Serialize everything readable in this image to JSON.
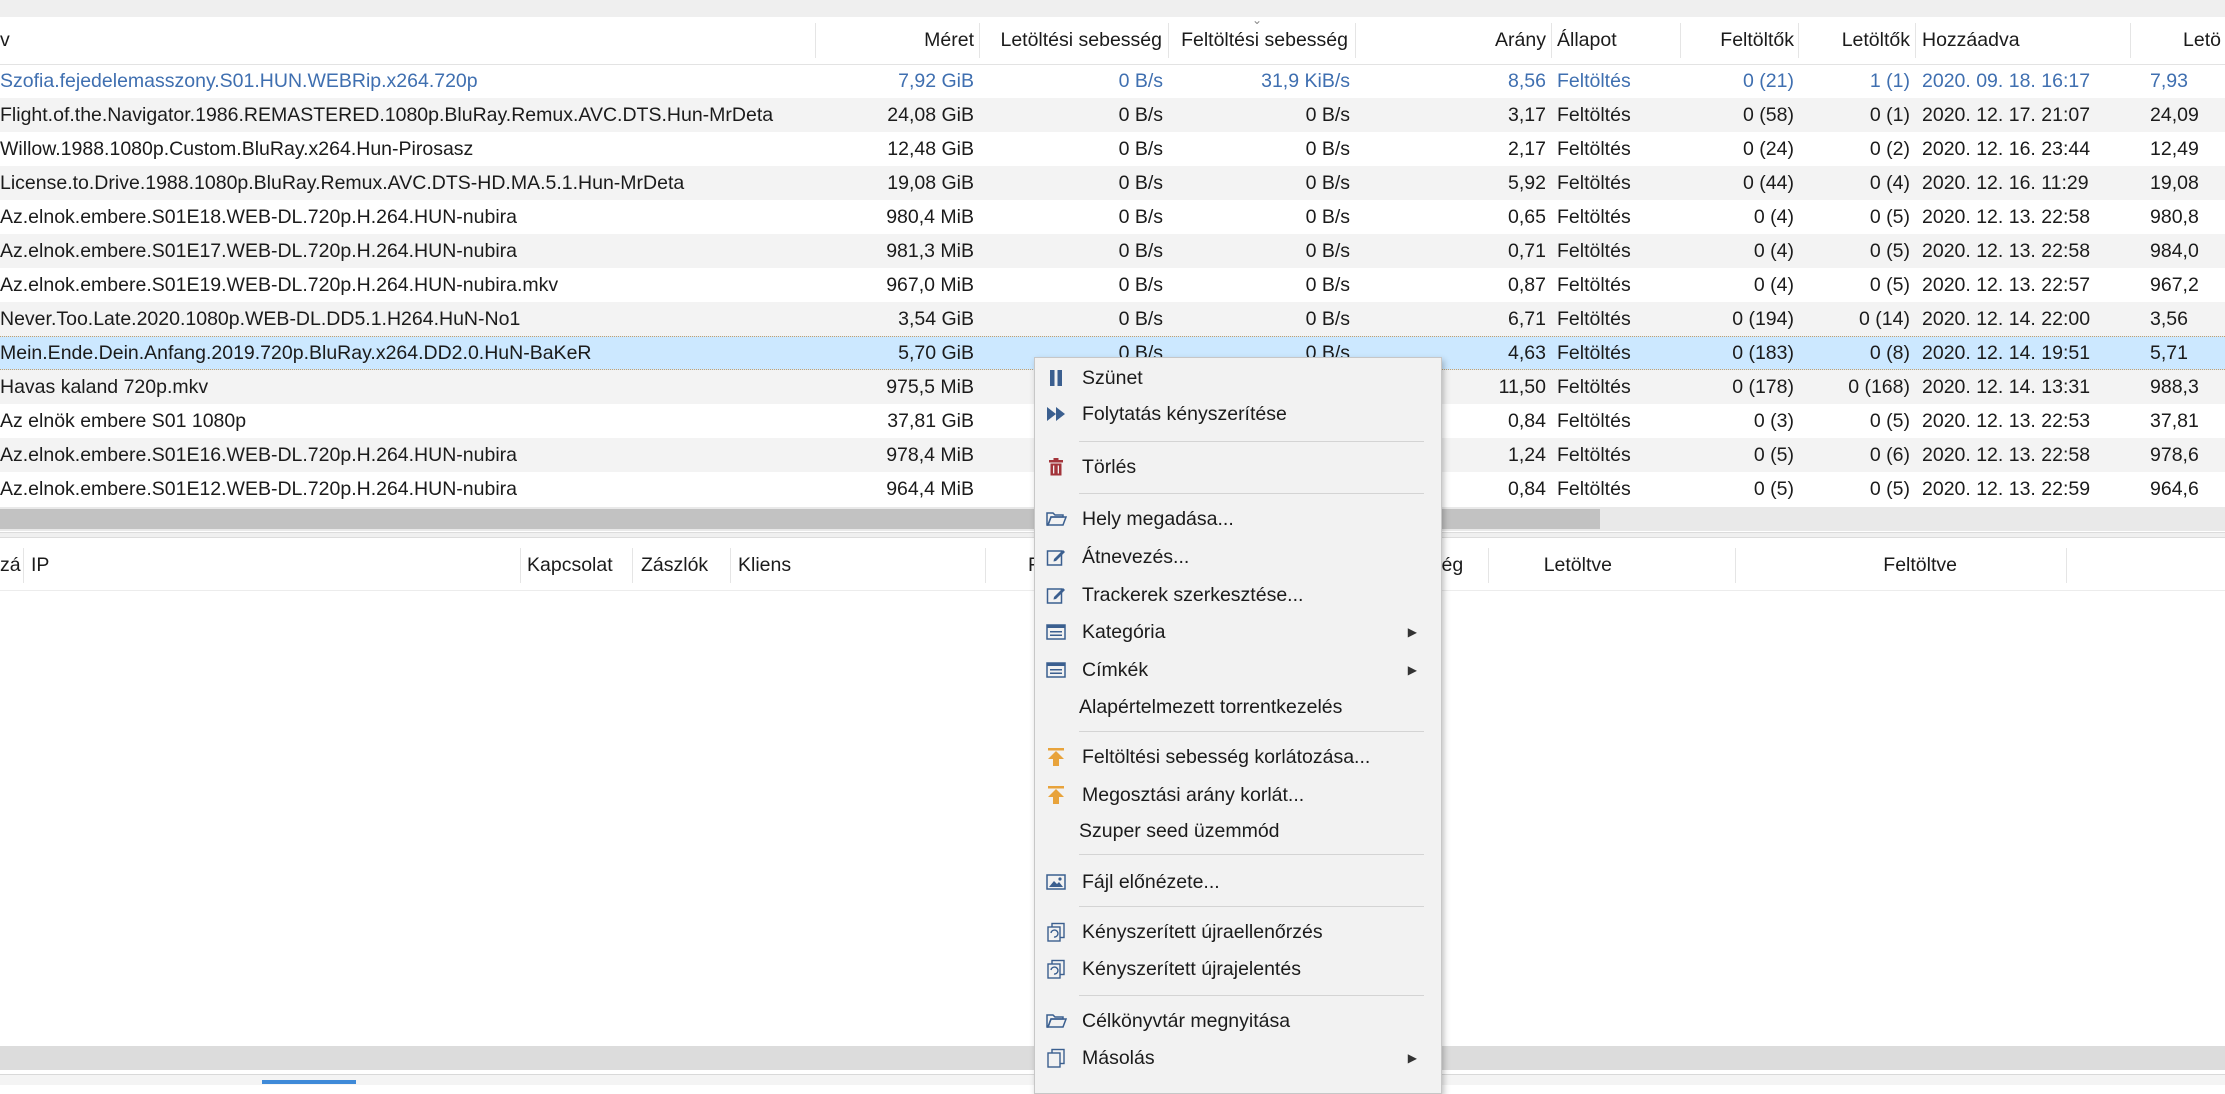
{
  "columns": {
    "name": "v",
    "size": "Méret",
    "dl_speed": "Letöltési sebesség",
    "ul_speed": "Feltöltési sebesség",
    "ratio": "Arány",
    "state": "Állapot",
    "seeds": "Feltöltők",
    "peers": "Letöltők",
    "added": "Hozzáadva",
    "extra": "Letö"
  },
  "torrents": [
    {
      "name": "Szofia.fejedelemasszony.S01.HUN.WEBRip.x264.720p",
      "size": "7,92 GiB",
      "dl": "0 B/s",
      "ul": "31,9 KiB/s",
      "ratio": "8,56",
      "state": "Feltöltés",
      "seeds": "0 (21)",
      "peers": "1 (1)",
      "added": "2020. 09. 18. 16:17",
      "extra": "7,93"
    },
    {
      "name": "Flight.of.the.Navigator.1986.REMASTERED.1080p.BluRay.Remux.AVC.DTS.Hun-MrDeta",
      "size": "24,08 GiB",
      "dl": "0 B/s",
      "ul": "0 B/s",
      "ratio": "3,17",
      "state": "Feltöltés",
      "seeds": "0 (58)",
      "peers": "0 (1)",
      "added": "2020. 12. 17. 21:07",
      "extra": "24,09"
    },
    {
      "name": "Willow.1988.1080p.Custom.BluRay.x264.Hun-Pirosasz",
      "size": "12,48 GiB",
      "dl": "0 B/s",
      "ul": "0 B/s",
      "ratio": "2,17",
      "state": "Feltöltés",
      "seeds": "0 (24)",
      "peers": "0 (2)",
      "added": "2020. 12. 16. 23:44",
      "extra": "12,49"
    },
    {
      "name": "License.to.Drive.1988.1080p.BluRay.Remux.AVC.DTS-HD.MA.5.1.Hun-MrDeta",
      "size": "19,08 GiB",
      "dl": "0 B/s",
      "ul": "0 B/s",
      "ratio": "5,92",
      "state": "Feltöltés",
      "seeds": "0 (44)",
      "peers": "0 (4)",
      "added": "2020. 12. 16. 11:29",
      "extra": "19,08"
    },
    {
      "name": "Az.elnok.embere.S01E18.WEB-DL.720p.H.264.HUN-nubira",
      "size": "980,4 MiB",
      "dl": "0 B/s",
      "ul": "0 B/s",
      "ratio": "0,65",
      "state": "Feltöltés",
      "seeds": "0 (4)",
      "peers": "0 (5)",
      "added": "2020. 12. 13. 22:58",
      "extra": "980,8"
    },
    {
      "name": "Az.elnok.embere.S01E17.WEB-DL.720p.H.264.HUN-nubira",
      "size": "981,3 MiB",
      "dl": "0 B/s",
      "ul": "0 B/s",
      "ratio": "0,71",
      "state": "Feltöltés",
      "seeds": "0 (4)",
      "peers": "0 (5)",
      "added": "2020. 12. 13. 22:58",
      "extra": "984,0"
    },
    {
      "name": "Az.elnok.embere.S01E19.WEB-DL.720p.H.264.HUN-nubira.mkv",
      "size": "967,0 MiB",
      "dl": "0 B/s",
      "ul": "0 B/s",
      "ratio": "0,87",
      "state": "Feltöltés",
      "seeds": "0 (4)",
      "peers": "0 (5)",
      "added": "2020. 12. 13. 22:57",
      "extra": "967,2"
    },
    {
      "name": "Never.Too.Late.2020.1080p.WEB-DL.DD5.1.H264.HuN-No1",
      "size": "3,54 GiB",
      "dl": "0 B/s",
      "ul": "0 B/s",
      "ratio": "6,71",
      "state": "Feltöltés",
      "seeds": "0 (194)",
      "peers": "0 (14)",
      "added": "2020. 12. 14. 22:00",
      "extra": "3,56"
    },
    {
      "name": "Mein.Ende.Dein.Anfang.2019.720p.BluRay.x264.DD2.0.HuN-BaKeR",
      "size": "5,70 GiB",
      "dl": "0 B/s",
      "ul": "0 B/s",
      "ratio": "4,63",
      "state": "Feltöltés",
      "seeds": "0 (183)",
      "peers": "0 (8)",
      "added": "2020. 12. 14. 19:51",
      "extra": "5,71"
    },
    {
      "name": "Havas kaland 720p.mkv",
      "size": "975,5 MiB",
      "dl": "",
      "ul": "",
      "ratio": "11,50",
      "state": "Feltöltés",
      "seeds": "0 (178)",
      "peers": "0 (168)",
      "added": "2020. 12. 14. 13:31",
      "extra": "988,3"
    },
    {
      "name": "Az elnök embere S01 1080p",
      "size": "37,81 GiB",
      "dl": "",
      "ul": "",
      "ratio": "0,84",
      "state": "Feltöltés",
      "seeds": "0 (3)",
      "peers": "0 (5)",
      "added": "2020. 12. 13. 22:53",
      "extra": "37,81"
    },
    {
      "name": "Az.elnok.embere.S01E16.WEB-DL.720p.H.264.HUN-nubira",
      "size": "978,4 MiB",
      "dl": "",
      "ul": "",
      "ratio": "1,24",
      "state": "Feltöltés",
      "seeds": "0 (5)",
      "peers": "0 (6)",
      "added": "2020. 12. 13. 22:58",
      "extra": "978,6"
    },
    {
      "name": "Az.elnok.embere.S01E12.WEB-DL.720p.H.264.HUN-nubira",
      "size": "964,4 MiB",
      "dl": "",
      "ul": "",
      "ratio": "0,84",
      "state": "Feltöltés",
      "seeds": "0 (5)",
      "peers": "0 (5)",
      "added": "2020. 12. 13. 22:59",
      "extra": "964,6"
    }
  ],
  "peer_columns": {
    "country": "zá",
    "ip": "IP",
    "connection": "Kapcsolat",
    "flags": "Zászlók",
    "client": "Kliens",
    "progress": "F",
    "speed": "sség",
    "downloaded": "Letöltve",
    "uploaded": "Feltöltve"
  },
  "context_menu": {
    "pause": "Szünet",
    "force_resume": "Folytatás kényszerítése",
    "delete": "Törlés",
    "set_location": "Hely megadása...",
    "rename": "Átnevezés...",
    "edit_trackers": "Trackerek szerkesztése...",
    "category": "Kategória",
    "tags": "Címkék",
    "auto_tmm": "Alapértelmezett torrentkezelés",
    "limit_upload": "Feltöltési sebesség korlátozása...",
    "limit_share_ratio": "Megosztási arány korlát...",
    "super_seeding": "Szuper seed üzemmód",
    "preview_file": "Fájl előnézete...",
    "force_recheck": "Kényszerített újraellenőrzés",
    "force_reannounce": "Kényszerített újrajelentés",
    "open_folder": "Célkönyvtár megnyitása",
    "copy": "Másolás"
  },
  "colors": {
    "selection": "#cce8ff",
    "alt_row": "#f3f3f3",
    "active_blue_text": "#3f6fb0",
    "menu_icon_blue": "#3b5f8f",
    "menu_icon_orange": "#e8a33b",
    "menu_icon_red": "#a3343a"
  }
}
